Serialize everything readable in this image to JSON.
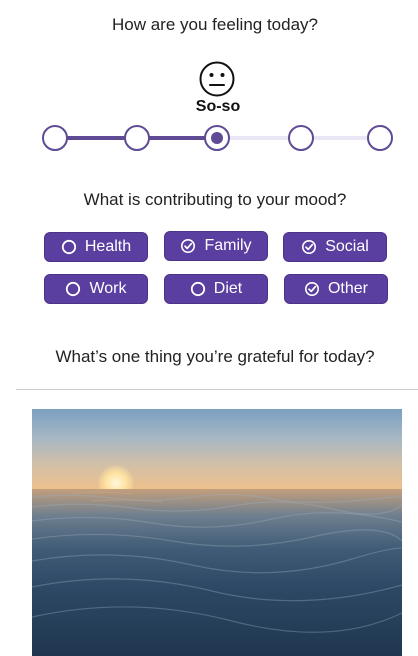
{
  "questions": {
    "feeling": "How are you feeling today?",
    "contributing": "What is contributing to your mood?",
    "grateful": "What’s one thing you’re grateful for today?"
  },
  "mood": {
    "icon": "neutral-face-icon",
    "label": "So-so",
    "steps": 5,
    "selected_step": 3
  },
  "factors": [
    {
      "label": "Health",
      "checked": false
    },
    {
      "label": "Family",
      "checked": true
    },
    {
      "label": "Social",
      "checked": true
    },
    {
      "label": "Work",
      "checked": false
    },
    {
      "label": "Diet",
      "checked": false
    },
    {
      "label": "Other",
      "checked": true
    }
  ],
  "colors": {
    "accent": "#5e4a95",
    "chip_bg": "#5b3fa0",
    "track_inactive": "#ebe6f6"
  }
}
